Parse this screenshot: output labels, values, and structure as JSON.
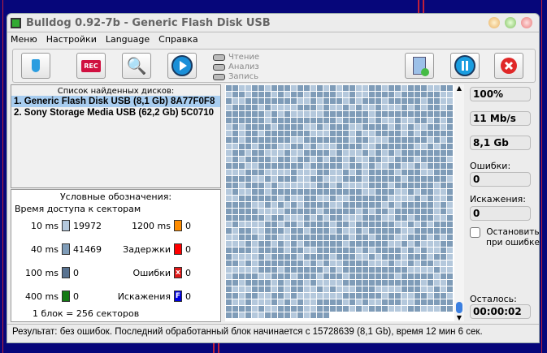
{
  "window": {
    "title": "Bulldog 0.92-7b - Generic Flash Disk USB"
  },
  "menu": [
    "Меню",
    "Настройки",
    "Language",
    "Справка"
  ],
  "toolbar": {
    "rec_label": "REC",
    "indicators": [
      "Чтение",
      "Анализ",
      "Запись"
    ]
  },
  "disks": {
    "header": "Список найденных дисков:",
    "items": [
      "1. Generic Flash Disk USB  (8,1 Gb) 8A77F0F8",
      "2. Sony Storage Media USB  (62,2 Gb) 5C0710"
    ],
    "selected": 0
  },
  "legend": {
    "title": "Условные обозначения:",
    "subtitle": "Время доступа к секторам",
    "left": [
      {
        "label": "10 ms",
        "count": "19972",
        "color": "#b4c8dc"
      },
      {
        "label": "40 ms",
        "count": "41469",
        "color": "#7f9cb8"
      },
      {
        "label": "100 ms",
        "count": "0",
        "color": "#587290"
      },
      {
        "label": "400 ms",
        "count": "0",
        "color": "#137a13"
      }
    ],
    "right": [
      {
        "label": "1200 ms",
        "count": "0",
        "color": "#ff8c00",
        "mark": ""
      },
      {
        "label": "Задержки",
        "count": "0",
        "color": "#ff0000",
        "mark": ""
      },
      {
        "label": "Ошибки",
        "count": "0",
        "color": "#e01818",
        "mark": "x"
      },
      {
        "label": "Искажения",
        "count": "0",
        "color": "#0000e0",
        "mark": "F"
      }
    ],
    "block_note": "1 блок = 256 секторов"
  },
  "stats": {
    "progress": "100%",
    "speed": "11 Mb/s",
    "size": "8,1 Gb",
    "errors_label": "Ошибки:",
    "errors": "0",
    "distortions_label": "Искажения:",
    "distortions": "0",
    "stop_on_error": "Остановить при ошибке",
    "stop_checked": false,
    "remaining_label": "Осталось:",
    "remaining": "00:00:02"
  },
  "status": "Результат: без ошибок. Последний обработанный блок начинается с 15728639 (8,1 Gb), время 12 мин 6 сек."
}
